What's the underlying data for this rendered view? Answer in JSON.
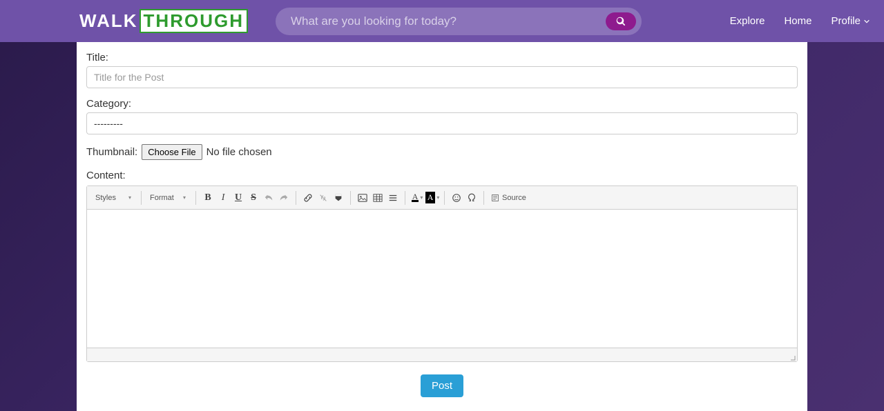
{
  "logo": {
    "part1": "WALK",
    "part2": "THROUGH"
  },
  "search": {
    "placeholder": "What are you looking for today?"
  },
  "nav": {
    "explore": "Explore",
    "home": "Home",
    "profile": "Profile"
  },
  "form": {
    "title_label": "Title:",
    "title_placeholder": "Title for the Post",
    "category_label": "Category:",
    "category_value": "---------",
    "thumbnail_label": "Thumbnail:",
    "choose_file": "Choose File",
    "no_file": "No file chosen",
    "content_label": "Content:"
  },
  "toolbar": {
    "styles": "Styles",
    "format": "Format",
    "source": "Source"
  },
  "post_button": "Post"
}
